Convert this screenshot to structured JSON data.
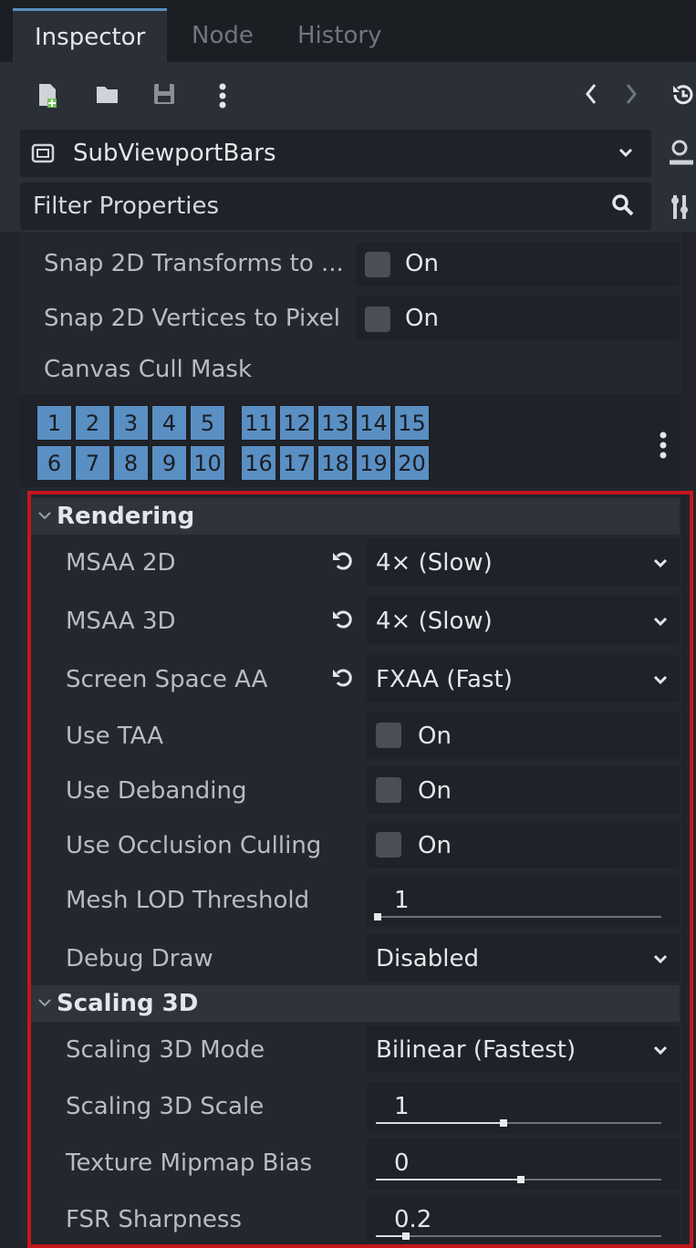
{
  "tabs": [
    {
      "label": "Inspector",
      "active": true
    },
    {
      "label": "Node",
      "active": false
    },
    {
      "label": "History",
      "active": false
    }
  ],
  "toolbar": {
    "icons": [
      "new-resource-icon",
      "open-folder-icon",
      "save-icon",
      "more-vert-icon",
      "back-arrow-icon",
      "forward-arrow-icon",
      "history-icon"
    ]
  },
  "node_selector": {
    "name": "SubViewportBars",
    "icon": "subviewport-icon"
  },
  "filter": {
    "placeholder": "Filter Properties"
  },
  "props_top": [
    {
      "label": "Snap 2D Transforms to ...",
      "value": "On"
    },
    {
      "label": "Snap 2D Vertices to Pixel",
      "value": "On"
    }
  ],
  "canvas_cull_mask": {
    "label": "Canvas Cull Mask",
    "bits_row1": [
      "1",
      "2",
      "3",
      "4",
      "5",
      "11",
      "12",
      "13",
      "14",
      "15"
    ],
    "bits_row2": [
      "6",
      "7",
      "8",
      "9",
      "10",
      "16",
      "17",
      "18",
      "19",
      "20"
    ]
  },
  "rendering": {
    "title": "Rendering",
    "msaa2d": {
      "label": "MSAA 2D",
      "value": "4× (Slow)"
    },
    "msaa3d": {
      "label": "MSAA 3D",
      "value": "4× (Slow)"
    },
    "ssaa": {
      "label": "Screen Space AA",
      "value": "FXAA (Fast)"
    },
    "taa": {
      "label": "Use TAA",
      "value": "On"
    },
    "debanding": {
      "label": "Use Debanding",
      "value": "On"
    },
    "occlusion": {
      "label": "Use Occlusion Culling",
      "value": "On"
    },
    "mesh_lod": {
      "label": "Mesh LOD Threshold",
      "value": "1",
      "fraction": 0.0
    },
    "debug_draw": {
      "label": "Debug Draw",
      "value": "Disabled"
    }
  },
  "scaling": {
    "title": "Scaling 3D",
    "mode": {
      "label": "Scaling 3D Mode",
      "value": "Bilinear (Fastest)"
    },
    "scale": {
      "label": "Scaling 3D Scale",
      "value": "1",
      "fraction": 0.44
    },
    "mipmap": {
      "label": "Texture Mipmap Bias",
      "value": "0",
      "fraction": 0.5
    },
    "fsr": {
      "label": "FSR Sharpness",
      "value": "0.2",
      "fraction": 0.1
    }
  },
  "colors": {
    "accent": "#5a8fc4",
    "highlight_border": "#c4161c"
  }
}
